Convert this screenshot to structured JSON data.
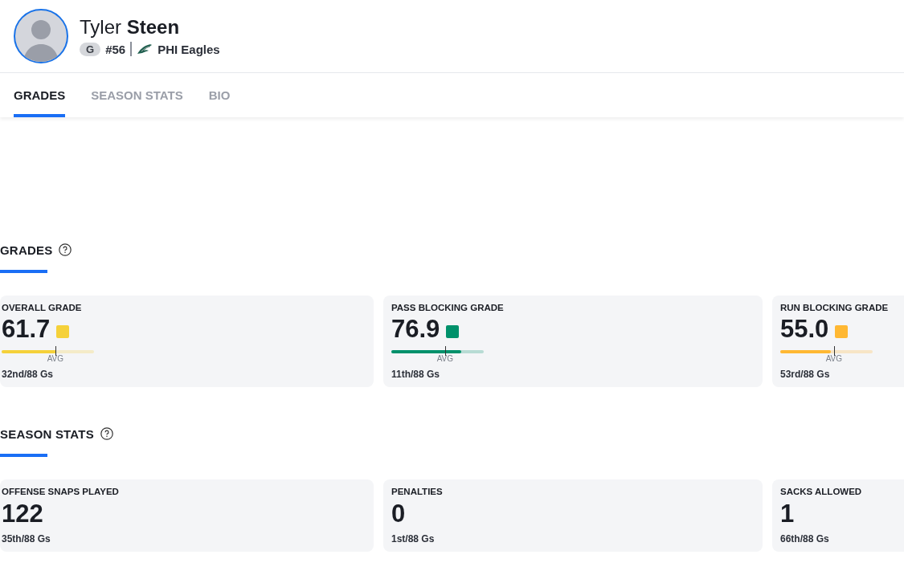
{
  "player": {
    "name": "Tyler **Steen**",
    "position": "G",
    "number": "#56",
    "team": "PHI Eagles"
  },
  "tabs": [
    {
      "label": "GRADES",
      "selected": true
    },
    {
      "label": "SEASON STATS",
      "selected": false
    },
    {
      "label": "BIO",
      "selected": false
    }
  ],
  "sections": [
    {
      "title": "GRADES",
      "kind": "grades",
      "cards": [
        {
          "label": "OVERALL GRADE",
          "value": "61.7",
          "color": "#f5d13a",
          "level": 0.59,
          "avg_label": "AVG",
          "rank": "32nd/88 Gs"
        },
        {
          "label": "PASS BLOCKING GRADE",
          "value": "76.9",
          "color": "#00916b",
          "level": 0.76,
          "avg_label": "AVG",
          "rank": "11th/88 Gs"
        },
        {
          "label": "RUN BLOCKING GRADE",
          "value": "55.0",
          "color": "#ffb833",
          "level": 0.55,
          "avg_label": "AVG",
          "rank": "53rd/88 Gs"
        }
      ]
    },
    {
      "title": "SEASON STATS",
      "kind": "stats",
      "cards": [
        {
          "label": "OFFENSE SNAPS PLAYED",
          "value": "122",
          "rank": "35th/88 Gs"
        },
        {
          "label": "PENALTIES",
          "value": "0",
          "rank": "1st/88 Gs"
        },
        {
          "label": "SACKS ALLOWED",
          "value": "1",
          "rank": "66th/88 Gs"
        }
      ]
    }
  ]
}
